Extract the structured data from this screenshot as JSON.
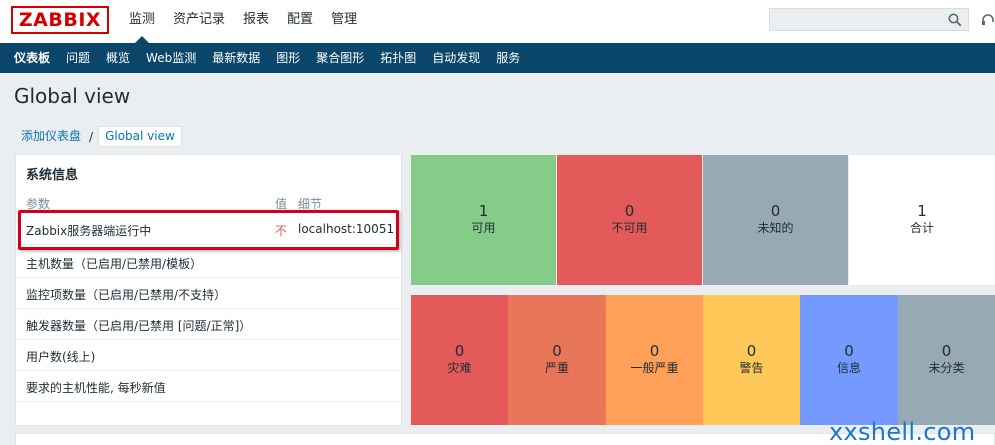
{
  "logo": {
    "text": "ZABBIX"
  },
  "main_menu": [
    "监测",
    "资产记录",
    "报表",
    "配置",
    "管理"
  ],
  "search": {
    "placeholder": ""
  },
  "sub_menu": [
    "仪表板",
    "问题",
    "概览",
    "Web监测",
    "最新数据",
    "图形",
    "聚合图形",
    "拓扑图",
    "自动发现",
    "服务"
  ],
  "page_title": "Global view",
  "breadcrumb": {
    "parent": "添加仪表盘",
    "separator": "/",
    "current": "Global view"
  },
  "system_info": {
    "title": "系统信息",
    "columns": {
      "param": "参数",
      "value": "值",
      "detail": "细节"
    },
    "rows": [
      {
        "param": "Zabbix服务器端运行中",
        "value": "不",
        "detail": "localhost:10051"
      },
      {
        "param": "主机数量（已启用/已禁用/模板）",
        "value": "",
        "detail": ""
      },
      {
        "param": "监控项数量（已启用/已禁用/不支持）",
        "value": "",
        "detail": ""
      },
      {
        "param": "触发器数量（已启用/已禁用 [问题/正常]）",
        "value": "",
        "detail": ""
      },
      {
        "param": "用户数(线上)",
        "value": "",
        "detail": ""
      },
      {
        "param": "要求的主机性能, 每秒新值",
        "value": "",
        "detail": ""
      }
    ]
  },
  "host_status": [
    {
      "count": "1",
      "label": "可用",
      "color": "#86cc89"
    },
    {
      "count": "0",
      "label": "不可用",
      "color": "#e45959"
    },
    {
      "count": "0",
      "label": "未知的",
      "color": "#97aab3"
    },
    {
      "count": "1",
      "label": "合计",
      "color": "#ffffff"
    }
  ],
  "problem_severity": [
    {
      "count": "0",
      "label": "灾难",
      "color": "#e45959"
    },
    {
      "count": "0",
      "label": "严重",
      "color": "#e97659"
    },
    {
      "count": "0",
      "label": "一般严重",
      "color": "#ffa059"
    },
    {
      "count": "0",
      "label": "警告",
      "color": "#ffc859"
    },
    {
      "count": "0",
      "label": "信息",
      "color": "#7499ff"
    },
    {
      "count": "0",
      "label": "未分类",
      "color": "#97aab3"
    }
  ],
  "watermark": "xxshell.com"
}
